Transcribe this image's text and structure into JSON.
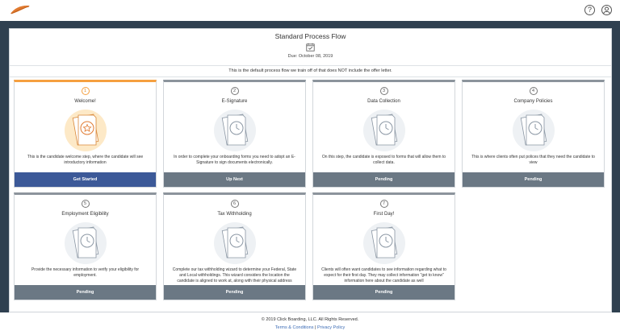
{
  "header": {
    "logo_icon": "feather-logo-icon",
    "help_icon": "question-circle-icon",
    "user_icon": "user-circle-icon"
  },
  "flow": {
    "title": "Standard Process Flow",
    "due": "Due: October 08, 2019",
    "description": "This is the default process flow we train off of that does NOT include the offer letter."
  },
  "colors": {
    "frame": "#2f4050",
    "active_accent": "#f5a040",
    "primary_button": "#3c5998",
    "pending_button": "#6b7884"
  },
  "steps": [
    {
      "number": "1",
      "title": "Welcome!",
      "description": "This is the candidate welcome step, where the candidate will see introductory information",
      "button": "Get Started",
      "icon": "star-icon"
    },
    {
      "number": "2",
      "title": "E-Signature",
      "description": "In order to complete your onboarding forms you need to adopt an E-Signature to sign documents electronically.",
      "button": "Up Next",
      "icon": "clock-icon"
    },
    {
      "number": "3",
      "title": "Data Collection",
      "description": "On this step, the candidate is exposed to forms that will allow them to collect data.",
      "button": "Pending",
      "icon": "clock-icon"
    },
    {
      "number": "4",
      "title": "Company Policies",
      "description": "This is where clients often put polices that they need the candidate to view",
      "button": "Pending",
      "icon": "clock-icon"
    },
    {
      "number": "5",
      "title": "Employment Eligibility",
      "description": "Provide the necessary information to verify your eligibility for employment.",
      "button": "Pending",
      "icon": "clock-icon"
    },
    {
      "number": "6",
      "title": "Tax Withholding",
      "description": "Complete our tax withholding wizard to determine your Federal, State and Local withholdings. This wizard considers the location the candidate is aligned to work at, along with their physical address",
      "button": "Pending",
      "icon": "clock-icon"
    },
    {
      "number": "7",
      "title": "First Day!",
      "description": "Clients will often want candidates to see information regarding what to expect for their first day. They may collect information \"get to know\" information here about the candidate as well",
      "button": "Pending",
      "icon": "clock-icon"
    }
  ],
  "footer": {
    "copyright": "© 2019 Click Boarding, LLC. All Rights Reserved.",
    "terms": "Terms & Conditions",
    "separator": "|",
    "privacy": "Privacy Policy"
  }
}
